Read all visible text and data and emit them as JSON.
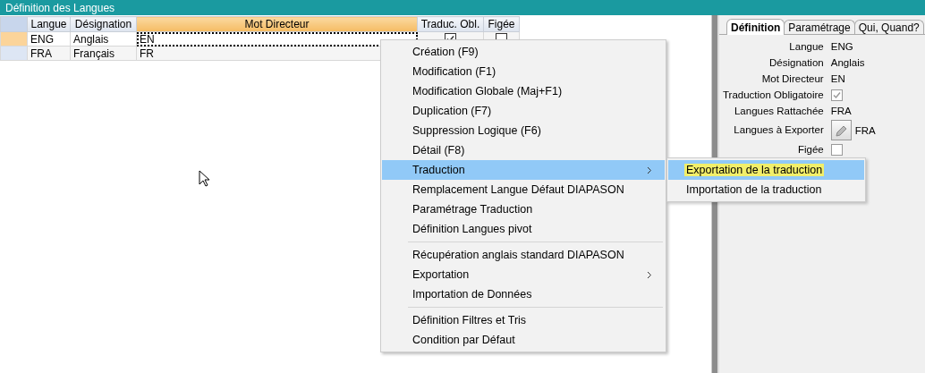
{
  "window": {
    "title": "Définition des Langues"
  },
  "grid": {
    "columns": [
      {
        "label": "Langue",
        "selected": false
      },
      {
        "label": "Désignation",
        "selected": false
      },
      {
        "label": "Mot Directeur",
        "selected": true
      },
      {
        "label": "Traduc. Obl.",
        "selected": false
      },
      {
        "label": "Figée",
        "selected": false
      }
    ],
    "rows": [
      {
        "selected": true,
        "cells": [
          "ENG",
          "Anglais",
          "EN"
        ],
        "traduc_obl": {
          "checked": true
        },
        "figee": {
          "checked": false
        }
      },
      {
        "selected": false,
        "cells": [
          "FRA",
          "Français",
          "FR"
        ]
      }
    ]
  },
  "context_menu": {
    "items": [
      {
        "label": "Création (F9)",
        "selected": false,
        "submenu": false,
        "separator_before": false
      },
      {
        "label": "Modification (F1)",
        "selected": false,
        "submenu": false,
        "separator_before": false
      },
      {
        "label": "Modification Globale (Maj+F1)",
        "selected": false,
        "submenu": false,
        "separator_before": false
      },
      {
        "label": "Duplication (F7)",
        "selected": false,
        "submenu": false,
        "separator_before": false
      },
      {
        "label": "Suppression Logique (F6)",
        "selected": false,
        "submenu": false,
        "separator_before": false
      },
      {
        "label": "Détail (F8)",
        "selected": false,
        "submenu": false,
        "separator_before": false
      },
      {
        "label": "Traduction",
        "selected": true,
        "submenu": true,
        "separator_before": false
      },
      {
        "label": "Remplacement Langue Défaut DIAPASON",
        "selected": false,
        "submenu": false,
        "separator_before": false
      },
      {
        "label": "Paramétrage Traduction",
        "selected": false,
        "submenu": false,
        "separator_before": false
      },
      {
        "label": "Définition Langues pivot",
        "selected": false,
        "submenu": false,
        "separator_before": false
      },
      {
        "label": "Récupération anglais standard DIAPASON",
        "selected": false,
        "submenu": false,
        "separator_before": true
      },
      {
        "label": "Exportation",
        "selected": false,
        "submenu": true,
        "separator_before": false
      },
      {
        "label": "Importation de Données",
        "selected": false,
        "submenu": false,
        "separator_before": false
      },
      {
        "label": "Définition Filtres et Tris",
        "selected": false,
        "submenu": false,
        "separator_before": true
      },
      {
        "label": "Condition par Défaut",
        "selected": false,
        "submenu": false,
        "separator_before": false
      }
    ]
  },
  "submenu": {
    "items": [
      {
        "label": "Exportation de la traduction",
        "selected": true
      },
      {
        "label": "Importation de la traduction",
        "selected": false
      }
    ]
  },
  "detail": {
    "tabs": [
      {
        "label": "Définition",
        "selected": true
      },
      {
        "label": "Paramétrage",
        "selected": false
      },
      {
        "label": "Qui, Quand?",
        "selected": false
      }
    ],
    "fields": [
      {
        "kind": "text",
        "label": "Langue",
        "value": "ENG"
      },
      {
        "kind": "text",
        "label": "Désignation",
        "value": "Anglais"
      },
      {
        "kind": "text",
        "label": "Mot Directeur",
        "value": "EN"
      },
      {
        "kind": "checkbox",
        "label": "Traduction Obligatoire",
        "checked": true
      },
      {
        "kind": "text",
        "label": "Langues Rattachée",
        "value": "FRA"
      },
      {
        "kind": "button",
        "label": "Langues à Exporter",
        "value": "FRA"
      },
      {
        "kind": "checkbox",
        "label": "Figée",
        "checked": false
      }
    ]
  }
}
